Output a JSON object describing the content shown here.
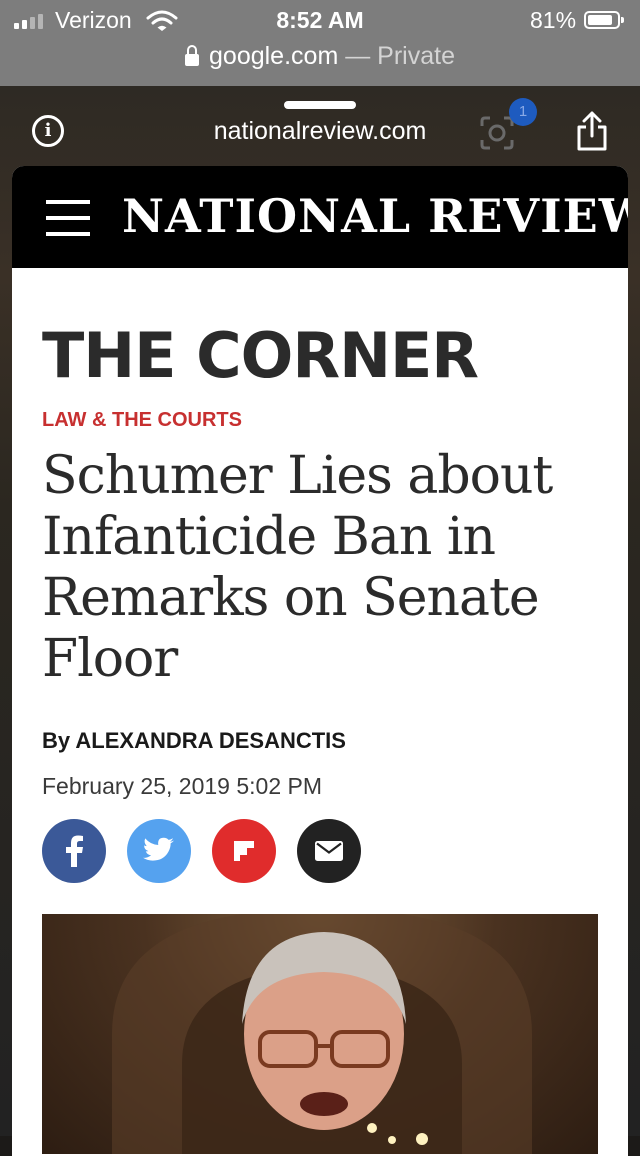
{
  "status_bar": {
    "carrier": "Verizon",
    "time": "8:52 AM",
    "battery": "81%"
  },
  "url_bar": {
    "domain": "google.com",
    "separator": " — ",
    "mode": "Private"
  },
  "amp_header": {
    "site": "nationalreview.com",
    "badge_count": "1"
  },
  "site_header": {
    "logo": "NATIONAL REVIEW"
  },
  "article": {
    "section": "THE CORNER",
    "category": "LAW & THE COURTS",
    "headline": "Schumer Lies about Infanticide Ban in Remarks on Senate Floor",
    "byline_prefix": "By ",
    "author": "ALEXANDRA DESANCTIS",
    "date": "February 25, 2019 5:02 PM"
  },
  "share_buttons": [
    {
      "name": "facebook",
      "icon": "facebook-icon",
      "color": "#3b5998"
    },
    {
      "name": "twitter",
      "icon": "twitter-icon",
      "color": "#55a2ef"
    },
    {
      "name": "flipboard",
      "icon": "flipboard-icon",
      "color": "#e02c2c"
    },
    {
      "name": "email",
      "icon": "mail-icon",
      "color": "#222222"
    }
  ],
  "colors": {
    "category_red": "#c73030",
    "status_gray": "#7d7d7d"
  }
}
